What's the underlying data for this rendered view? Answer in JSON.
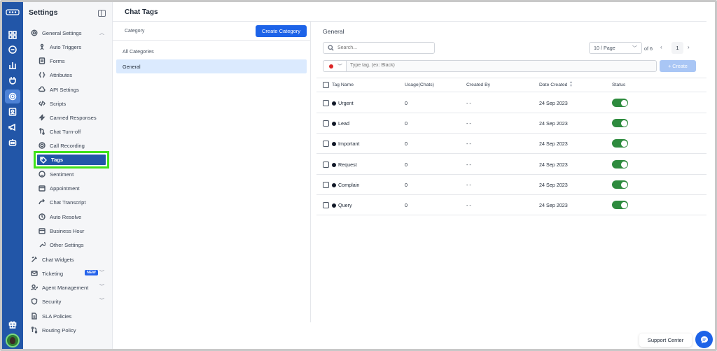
{
  "sidebar": {
    "title": "Settings",
    "general_settings": "General Settings",
    "sub_items": [
      {
        "label": "Auto Triggers",
        "icon": "auto-triggers-icon"
      },
      {
        "label": "Forms",
        "icon": "forms-icon"
      },
      {
        "label": "Attributes",
        "icon": "attributes-icon"
      },
      {
        "label": "API Settings",
        "icon": "api-settings-icon"
      },
      {
        "label": "Scripts",
        "icon": "scripts-icon"
      },
      {
        "label": "Canned Responses",
        "icon": "canned-responses-icon"
      },
      {
        "label": "Chat Turn-off",
        "icon": "chat-turn-off-icon"
      },
      {
        "label": "Call Recording",
        "icon": "call-recording-icon"
      },
      {
        "label": "Tags",
        "icon": "tag-icon"
      },
      {
        "label": "Sentiment",
        "icon": "sentiment-icon"
      },
      {
        "label": "Appointment",
        "icon": "appointment-icon"
      },
      {
        "label": "Chat Transcript",
        "icon": "chat-transcript-icon"
      },
      {
        "label": "Auto Resolve",
        "icon": "auto-resolve-icon"
      },
      {
        "label": "Business Hour",
        "icon": "business-hour-icon"
      },
      {
        "label": "Other Settings",
        "icon": "other-settings-icon"
      }
    ],
    "top_items": [
      {
        "label": "Chat Widgets",
        "icon": "chat-widgets-icon"
      },
      {
        "label": "Ticketing",
        "icon": "ticketing-icon",
        "badge": "NEW"
      },
      {
        "label": "Agent Management",
        "icon": "agent-management-icon"
      },
      {
        "label": "Security",
        "icon": "security-icon"
      },
      {
        "label": "SLA Policies",
        "icon": "sla-policies-icon"
      },
      {
        "label": "Routing Policy",
        "icon": "routing-policy-icon"
      }
    ]
  },
  "header": {
    "title": "Chat Tags"
  },
  "category_panel": {
    "label": "Category",
    "create_button": "Create Category",
    "items": [
      "All Categories",
      "General"
    ],
    "selected": "General"
  },
  "tags_panel": {
    "title": "General",
    "search_placeholder": "Search...",
    "page_size": "10 / Page",
    "page_of": "of 6",
    "current_page": "1",
    "tag_input_placeholder": "Type tag. (ex: Black)",
    "create_button": "+ Create",
    "columns": [
      "Tag Name",
      "Usage(Chats)",
      "Created By",
      "Date Created",
      "Status"
    ],
    "rows": [
      {
        "name": "Urgent",
        "usage": "0",
        "created_by": "- -",
        "date": "24 Sep 2023",
        "enabled": true
      },
      {
        "name": "Lead",
        "usage": "0",
        "created_by": "- -",
        "date": "24 Sep 2023",
        "enabled": true
      },
      {
        "name": "Important",
        "usage": "0",
        "created_by": "- -",
        "date": "24 Sep 2023",
        "enabled": true
      },
      {
        "name": "Request",
        "usage": "0",
        "created_by": "- -",
        "date": "24 Sep 2023",
        "enabled": true
      },
      {
        "name": "Complain",
        "usage": "0",
        "created_by": "- -",
        "date": "24 Sep 2023",
        "enabled": true
      },
      {
        "name": "Query",
        "usage": "0",
        "created_by": "- -",
        "date": "24 Sep 2023",
        "enabled": true
      }
    ]
  },
  "footer": {
    "support_label": "Support Center"
  },
  "colors": {
    "rail": "#2256a8",
    "primary": "#1d63e8",
    "toggle_on": "#2e8b3e",
    "highlight": "#3fe21a",
    "selected_category": "#dbeafe"
  }
}
